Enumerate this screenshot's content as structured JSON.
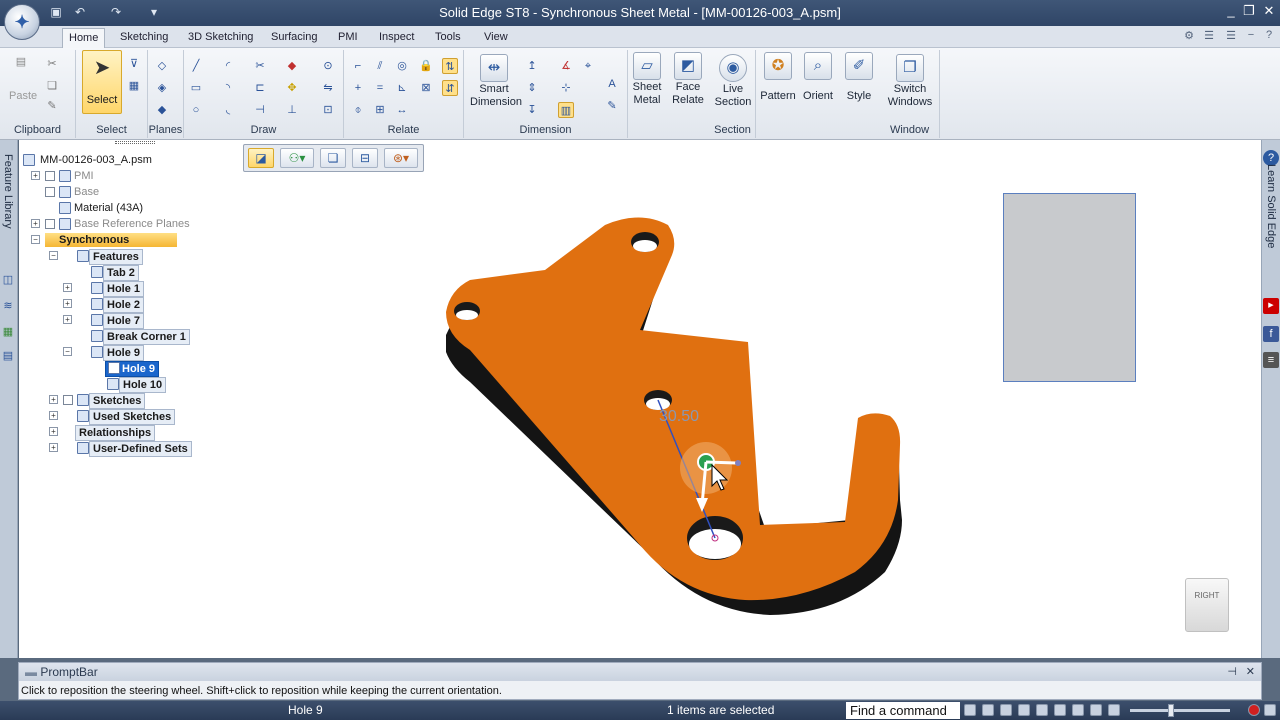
{
  "window": {
    "title": "Solid Edge ST8 - Synchronous Sheet Metal - [MM-00126-003_A.psm]"
  },
  "tabs": [
    {
      "label": "Home",
      "active": true
    },
    {
      "label": "Sketching"
    },
    {
      "label": "3D Sketching"
    },
    {
      "label": "Surfacing"
    },
    {
      "label": "PMI"
    },
    {
      "label": "Inspect"
    },
    {
      "label": "Tools"
    },
    {
      "label": "View"
    }
  ],
  "ribbon": {
    "groups": [
      "Clipboard",
      "Select",
      "Planes",
      "Draw",
      "Relate",
      "Dimension",
      "Section",
      "Window"
    ],
    "buttons": {
      "paste": "Paste",
      "select": "Select",
      "smart_dimension": [
        "Smart",
        "Dimension"
      ],
      "sheet_metal": [
        "Sheet",
        "Metal"
      ],
      "face_relate": [
        "Face",
        "Relate"
      ],
      "live_section": [
        "Live",
        "Section"
      ],
      "pattern": "Pattern",
      "orient": "Orient",
      "style": "Style",
      "switch_windows": [
        "Switch",
        "Windows"
      ]
    }
  },
  "side_panels": {
    "left": "Feature Library",
    "right": "Learn Solid Edge"
  },
  "tree": {
    "rows": [
      {
        "label": "MM-00126-003_A.psm",
        "style": "plain"
      },
      {
        "label": "PMI",
        "style": "dim"
      },
      {
        "label": "Base",
        "style": "dim"
      },
      {
        "label": "Material (43A)",
        "style": "plain"
      },
      {
        "label": "Base Reference Planes",
        "style": "dim"
      },
      {
        "label": "Synchronous",
        "style": "sync"
      },
      {
        "label": "Features",
        "style": "boxed"
      },
      {
        "label": "Tab 2",
        "style": "boxed"
      },
      {
        "label": "Hole 1",
        "style": "boxed"
      },
      {
        "label": "Hole 2",
        "style": "boxed"
      },
      {
        "label": "Hole 7",
        "style": "boxed"
      },
      {
        "label": "Break Corner 1",
        "style": "boxed"
      },
      {
        "label": "Hole 9",
        "style": "boxed"
      },
      {
        "label": "Hole 9",
        "style": "selected"
      },
      {
        "label": "Hole 10",
        "style": "boxed"
      },
      {
        "label": "Sketches",
        "style": "boxed"
      },
      {
        "label": "Used Sketches",
        "style": "boxed"
      },
      {
        "label": "Relationships",
        "style": "boxed"
      },
      {
        "label": "User-Defined Sets",
        "style": "boxed"
      }
    ]
  },
  "viewport": {
    "dimension_value": "30.50",
    "view_cube_face": "RIGHT",
    "part_color": "#e07010"
  },
  "promptbar": {
    "title": "PromptBar",
    "message": "Click to reposition the steering wheel.  Shift+click to reposition while keeping the current orientation."
  },
  "statusbar": {
    "feature": "Hole 9",
    "selection": "1 items are selected",
    "find_command": "Find a command"
  }
}
